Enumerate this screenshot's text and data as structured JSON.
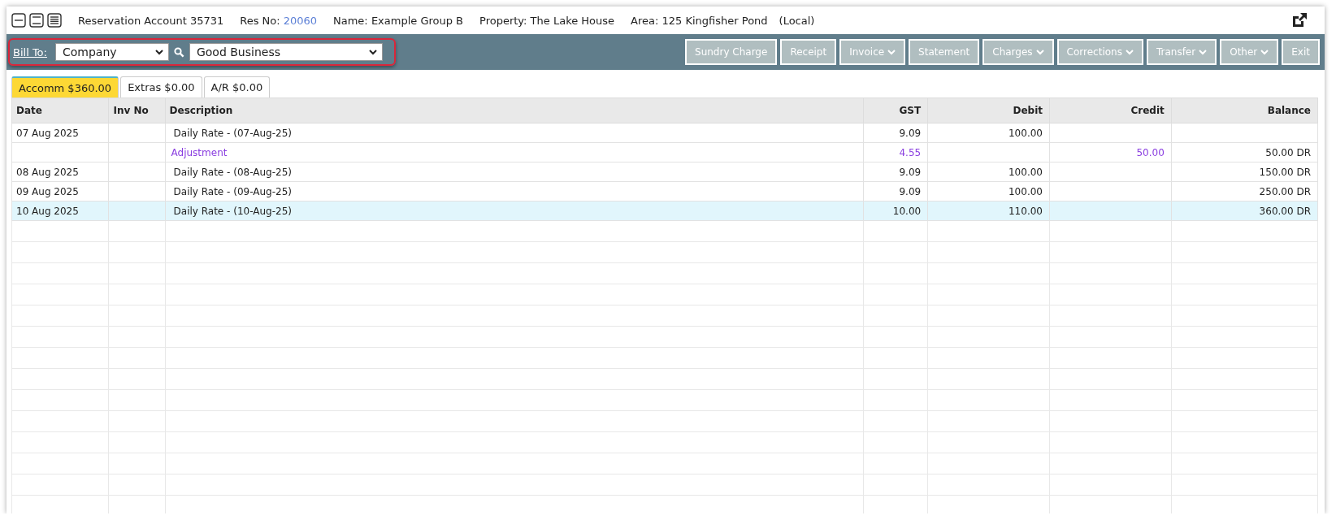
{
  "header": {
    "title": "Reservation Account 35731",
    "res_no_label": "Res No:",
    "res_no": "20060",
    "name": "Name: Example Group B",
    "property": "Property: The Lake House",
    "area": "Area: 125 Kingfisher Pond",
    "locality": "(Local)"
  },
  "bill_to": {
    "label": "Bill To:",
    "type": "Company",
    "account": "Good Business",
    "highlighted": true
  },
  "actions": [
    {
      "label": "Sundry Charge",
      "has_menu": false
    },
    {
      "label": "Receipt",
      "has_menu": false
    },
    {
      "label": "Invoice",
      "has_menu": true
    },
    {
      "label": "Statement",
      "has_menu": false
    },
    {
      "label": "Charges",
      "has_menu": true
    },
    {
      "label": "Corrections",
      "has_menu": true
    },
    {
      "label": "Transfer",
      "has_menu": true
    },
    {
      "label": "Other",
      "has_menu": true
    },
    {
      "label": "Exit",
      "has_menu": false
    }
  ],
  "tabs": [
    {
      "label": "Accomm $360.00",
      "selected": true
    },
    {
      "label": "Extras $0.00",
      "selected": false
    },
    {
      "label": "A/R $0.00",
      "selected": false
    }
  ],
  "table": {
    "columns": [
      "Date",
      "Inv No",
      "Description",
      "GST",
      "Debit",
      "Credit",
      "Balance"
    ],
    "rows": [
      {
        "kind": "charge",
        "selected": false,
        "cells": [
          "07 Aug 2025",
          "",
          "Daily Rate  - (07-Aug-25)",
          "9.09",
          "100.00",
          "",
          ""
        ]
      },
      {
        "kind": "adjustment",
        "selected": false,
        "cells": [
          "",
          "",
          "Adjustment",
          "4.55",
          "",
          "50.00",
          "50.00 DR"
        ]
      },
      {
        "kind": "charge",
        "selected": false,
        "cells": [
          "08 Aug 2025",
          "",
          "Daily Rate  - (08-Aug-25)",
          "9.09",
          "100.00",
          "",
          "150.00 DR"
        ]
      },
      {
        "kind": "charge",
        "selected": false,
        "cells": [
          "09 Aug 2025",
          "",
          "Daily Rate  - (09-Aug-25)",
          "9.09",
          "100.00",
          "",
          "250.00 DR"
        ]
      },
      {
        "kind": "charge",
        "selected": true,
        "cells": [
          "10 Aug 2025",
          "",
          "Daily Rate  - (10-Aug-25)",
          "10.00",
          "110.00",
          "",
          "360.00 DR"
        ]
      }
    ]
  }
}
